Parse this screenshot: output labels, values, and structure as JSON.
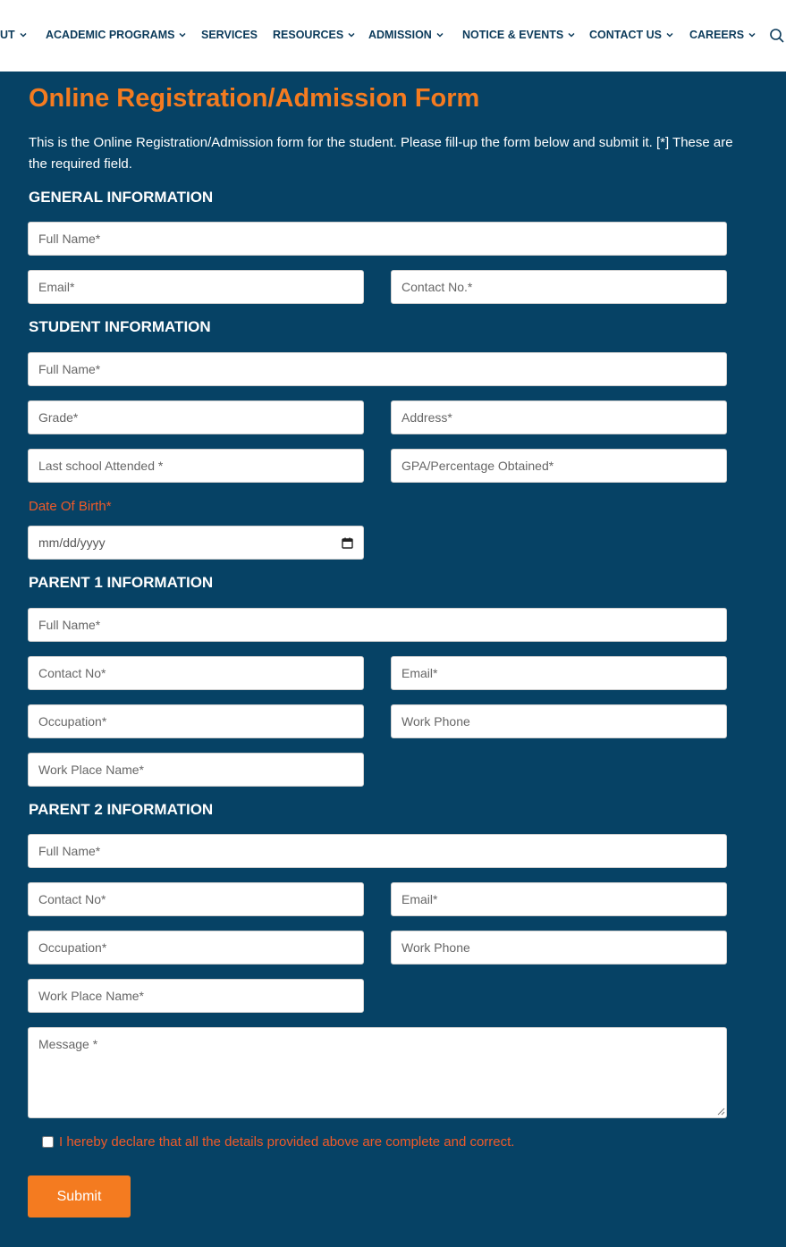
{
  "nav": {
    "items": [
      {
        "label": "UT",
        "chevron": true
      },
      {
        "label": "ACADEMIC PROGRAMS",
        "chevron": true
      },
      {
        "label": "SERVICES",
        "chevron": false
      },
      {
        "label": "RESOURCES",
        "chevron": true
      },
      {
        "label": "ADMISSION",
        "chevron": true
      },
      {
        "label": "NOTICE & EVENTS",
        "chevron": true
      },
      {
        "label": "CONTACT US",
        "chevron": true
      },
      {
        "label": "CAREERS",
        "chevron": true
      }
    ],
    "search_icon": "search-icon"
  },
  "form": {
    "title": "Online Registration/Admission Form",
    "intro": "This is the Online Registration/Admission form for the student. Please fill-up the form below and submit it. [*] These are the required field.",
    "sections": {
      "general": "GENERAL INFORMATION",
      "student": "STUDENT INFORMATION",
      "parent1": "PARENT 1 INFORMATION",
      "parent2": "PARENT 2 INFORMATION"
    },
    "general": {
      "full_name": "Full Name*",
      "email": "Email*",
      "contact": "Contact No.*"
    },
    "student": {
      "full_name": "Full Name*",
      "grade": "Grade*",
      "address": "Address*",
      "last_school": "Last school Attended *",
      "gpa": "GPA/Percentage Obtained*",
      "dob_label": "Date Of Birth*",
      "dob_placeholder": "mm/dd/yyyy"
    },
    "parent1": {
      "full_name": "Full Name*",
      "contact": "Contact No*",
      "email": "Email*",
      "occupation": "Occupation*",
      "work_phone": "Work Phone",
      "work_place": "Work Place Name*"
    },
    "parent2": {
      "full_name": "Full Name*",
      "contact": "Contact No*",
      "email": "Email*",
      "occupation": "Occupation*",
      "work_phone": "Work Phone",
      "work_place": "Work Place Name*"
    },
    "message_placeholder": "Message *",
    "declaration": "I hereby declare that all the details provided above are complete and correct.",
    "submit_label": "Submit"
  },
  "colors": {
    "background": "#064265",
    "accent": "#f47b20",
    "required_label": "#f05a28",
    "nav_text": "#0b3a5a"
  }
}
